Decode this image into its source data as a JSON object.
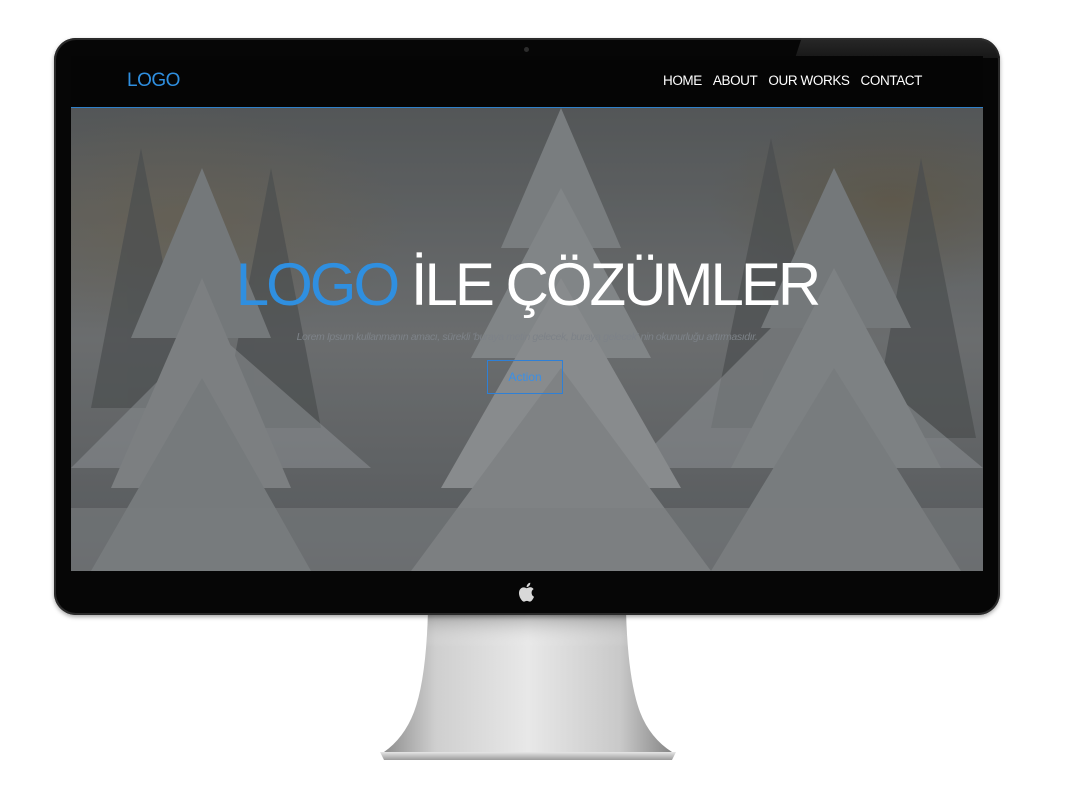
{
  "navbar": {
    "logo": "LOGO",
    "menu": [
      {
        "label": "HOME"
      },
      {
        "label": "ABOUT"
      },
      {
        "label": "OUR WORKS"
      },
      {
        "label": "CONTACT"
      }
    ]
  },
  "hero": {
    "title_accent": "LOGO",
    "title_rest": " İLE ÇÖZÜMLER",
    "subtitle": "Lorem Ipsum kullanmanın amacı, sürekli 'buraya metin gelecek, buraya gelecek' nin okunurluğu artırmasıdır.",
    "action_label": "Action"
  },
  "colors": {
    "accent": "#2f8fe0",
    "navbar_bg": "#050505",
    "frame": "#060606"
  },
  "icons": {
    "brand": "apple-icon",
    "camera": "camera-icon"
  }
}
